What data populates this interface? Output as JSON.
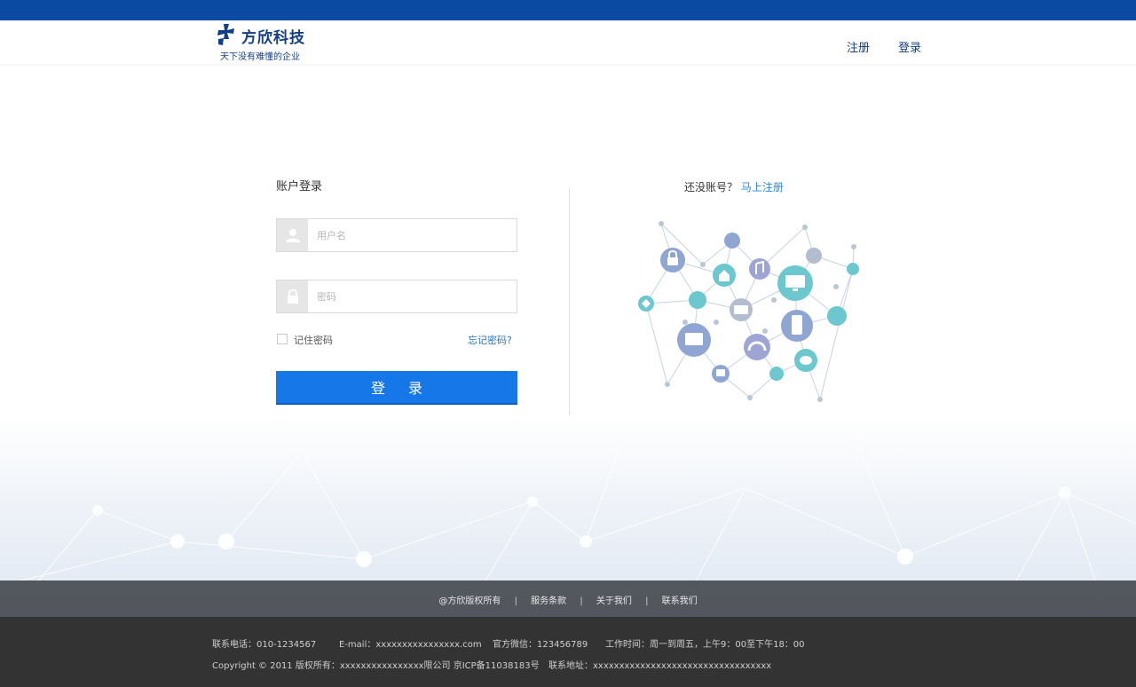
{
  "header": {
    "logo_name": "方欣科技",
    "logo_slogan": "天下没有难懂的企业",
    "nav_register": "注册",
    "nav_login": "登录"
  },
  "login": {
    "title": "账户登录",
    "username_placeholder": "用户名",
    "password_placeholder": "密码",
    "remember_label": "记住密码",
    "forgot_label": "忘记密码?",
    "submit_label": "登录"
  },
  "register": {
    "prompt": "还没账号？",
    "link": "马上注册"
  },
  "footer": {
    "links": [
      "@方欣版权所有",
      "服务条款",
      "关于我们",
      "联系我们"
    ],
    "phone": "联系电话：010-1234567",
    "email": "E-mail：xxxxxxxxxxxxxxxx.com",
    "wechat": "官方微信：123456789",
    "hours": "工作时间：周一到周五，上午9：00至下午18：00",
    "copyright": "Copyright © 2011 版权所有：xxxxxxxxxxxxxxxx限公司 京ICP备11038183号",
    "address": "联系地址：xxxxxxxxxxxxxxxxxxxxxxxxxxxxxxxxxx"
  },
  "colors": {
    "topbar": "#0b4aa3",
    "brand_text": "#123f86",
    "primary_button": "#1677e8",
    "link": "#2a8be0",
    "footer_dark": "#333333"
  }
}
